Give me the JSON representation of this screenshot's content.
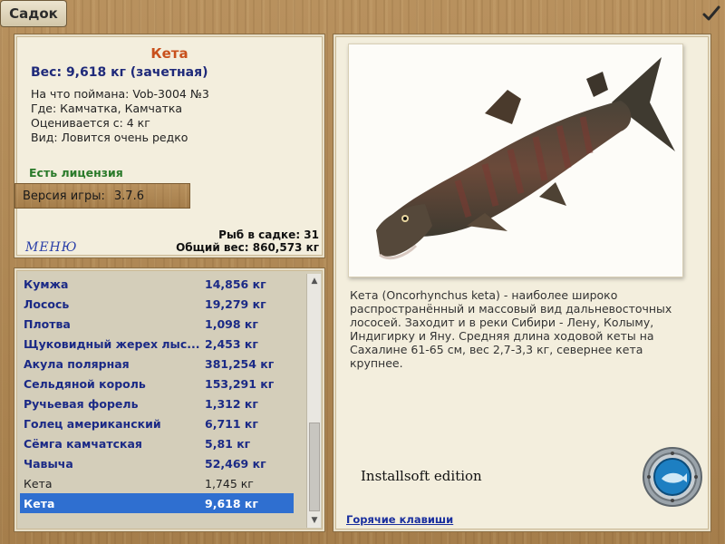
{
  "window": {
    "title": "Садок",
    "ok_icon": "checkmark-icon"
  },
  "info": {
    "fish_name": "Кета",
    "weight": "Вес: 9,618 кг (зачетная)",
    "lines": [
      "На что поймана: Vob-3004 №3",
      "Где: Камчатка, Камчатка",
      "Оценивается с: 4 кг",
      "Вид: Ловится очень редко"
    ],
    "license": "Есть лицензия",
    "version_label": "Версия игры:",
    "version_value": "3.7.6",
    "menu_label": "МЕНЮ",
    "fish_count": "Рыб в садке: 31",
    "total_weight": "Общий вес: 860,573 кг"
  },
  "catch_list": [
    {
      "name": "Кумжа",
      "weight": "14,856 кг",
      "style": "rare"
    },
    {
      "name": "Лосось",
      "weight": "19,279 кг",
      "style": "rare"
    },
    {
      "name": "Плотва",
      "weight": "1,098 кг",
      "style": "rare"
    },
    {
      "name": "Щуковидный жерех лыс...",
      "weight": "2,453 кг",
      "style": "rare"
    },
    {
      "name": "Акула полярная",
      "weight": "381,254 кг",
      "style": "rare"
    },
    {
      "name": "Сельдяной король",
      "weight": "153,291 кг",
      "style": "rare"
    },
    {
      "name": "Ручьевая форель",
      "weight": "1,312 кг",
      "style": "rare"
    },
    {
      "name": "Голец американский",
      "weight": "6,711 кг",
      "style": "rare"
    },
    {
      "name": "Сёмга камчатская",
      "weight": "5,81 кг",
      "style": "rare"
    },
    {
      "name": "Чавыча",
      "weight": "52,469 кг",
      "style": "rare"
    },
    {
      "name": "Кета",
      "weight": "1,745 кг",
      "style": "common"
    },
    {
      "name": "Кета",
      "weight": "9,618 кг",
      "style": "sel"
    }
  ],
  "description": {
    "image_icon": "fish-image",
    "text": "Кета (Oncorhynchus keta) - наиболее широко распространённый и массовый вид дальневосточных лососей. Заходит и в реки Сибири - Лену, Колыму, Индигирку и Яну. Средняя длина ходовой кеты на Сахалине 61-65 см, вес 2,7-3,3 кг, севернее кета крупнее.",
    "watermark": "Installsoft edition",
    "hotkeys_label": "Горячие клавиши",
    "porthole_icon": "porthole-fish-icon"
  },
  "colors": {
    "accent_name": "#c8501c",
    "rare_text": "#1b2a86",
    "selection": "#2f6fd0",
    "license": "#2a7a2a"
  }
}
